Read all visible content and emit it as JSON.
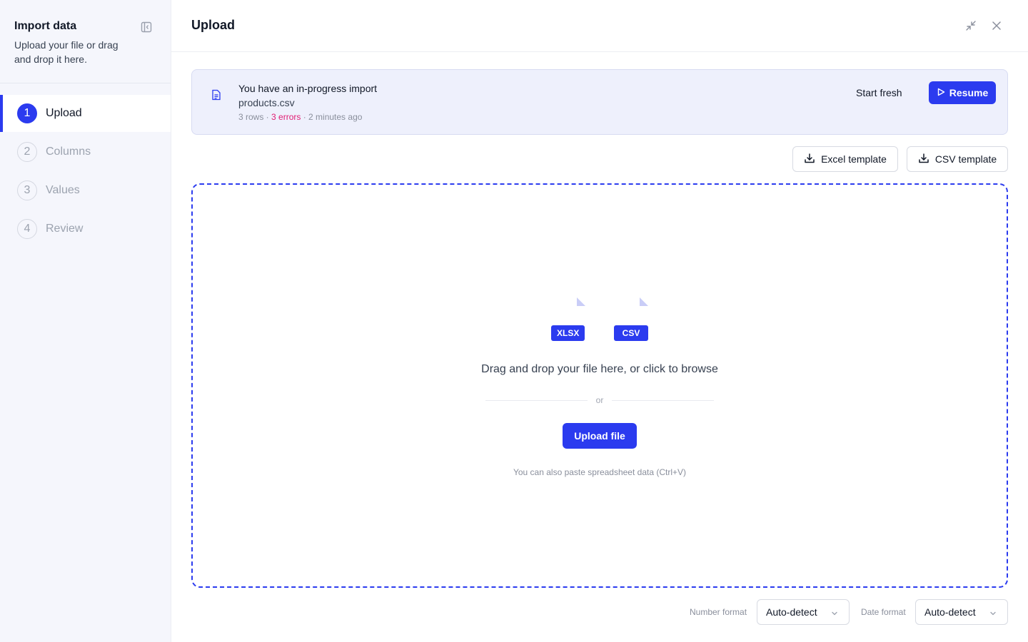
{
  "sidebar": {
    "title": "Import data",
    "subtitle": "Upload your file or drag and drop it here.",
    "steps": [
      {
        "number": "1",
        "label": "Upload",
        "active": true
      },
      {
        "number": "2",
        "label": "Columns",
        "active": false
      },
      {
        "number": "3",
        "label": "Values",
        "active": false
      },
      {
        "number": "4",
        "label": "Review",
        "active": false
      }
    ]
  },
  "header": {
    "title": "Upload"
  },
  "banner": {
    "title": "You have an in-progress import",
    "file_name": "products.csv",
    "rows": "3 rows",
    "separator": " · ",
    "errors": "3 errors",
    "time": "2 minutes ago",
    "start_fresh_label": "Start fresh",
    "resume_label": "Resume"
  },
  "templates": {
    "excel_label": "Excel template",
    "csv_label": "CSV template"
  },
  "dropzone": {
    "formats": [
      "XLSX",
      "CSV"
    ],
    "title": "Drag and drop your file here, or click to browse",
    "or_text": "or",
    "upload_label": "Upload file",
    "paste_hint": "You can also paste spreadsheet data (Ctrl+V)"
  },
  "footer": {
    "number_format_label": "Number format",
    "number_format_value": "Auto-detect",
    "date_format_label": "Date format",
    "date_format_value": "Auto-detect"
  },
  "colors": {
    "accent": "#2b3bef",
    "sidebar_bg": "#f5f6fc",
    "banner_bg": "#eef0fc",
    "error": "#e11d74"
  }
}
